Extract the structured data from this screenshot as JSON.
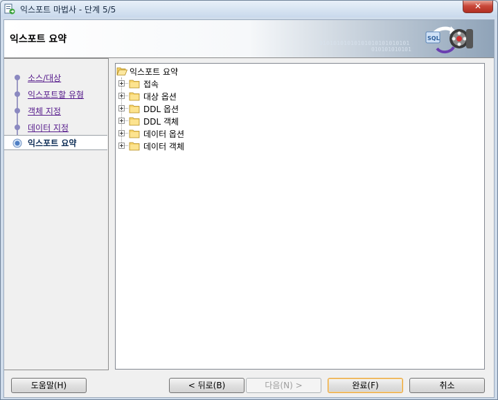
{
  "window": {
    "title": "익스포트 마법사 - 단계 5/5",
    "close_label": "✕"
  },
  "header": {
    "title": "익스포트 요약",
    "binary_line1": "01010101010101010101010101",
    "binary_line2": "010101010101",
    "graphic_label": "SQL"
  },
  "steps": [
    {
      "label": "소스/대상",
      "state": "done"
    },
    {
      "label": "익스포트할 유형",
      "state": "done"
    },
    {
      "label": "객체 지정",
      "state": "done"
    },
    {
      "label": "데이터 지정",
      "state": "done"
    },
    {
      "label": "익스포트 요약",
      "state": "current"
    }
  ],
  "tree": {
    "root": "익스포트 요약",
    "children": [
      "접속",
      "대상 옵션",
      "DDL 옵션",
      "DDL 객체",
      "데이터 옵션",
      "데이터 객체"
    ]
  },
  "buttons": {
    "help": "도움말(H)",
    "back": "< 뒤로(B)",
    "next": "다음(N) >",
    "finish": "완료(F)",
    "cancel": "취소"
  },
  "colors": {
    "link": "#551a8b",
    "accent_default_button": "#e6a23c",
    "step_line": "#9b99c4"
  }
}
